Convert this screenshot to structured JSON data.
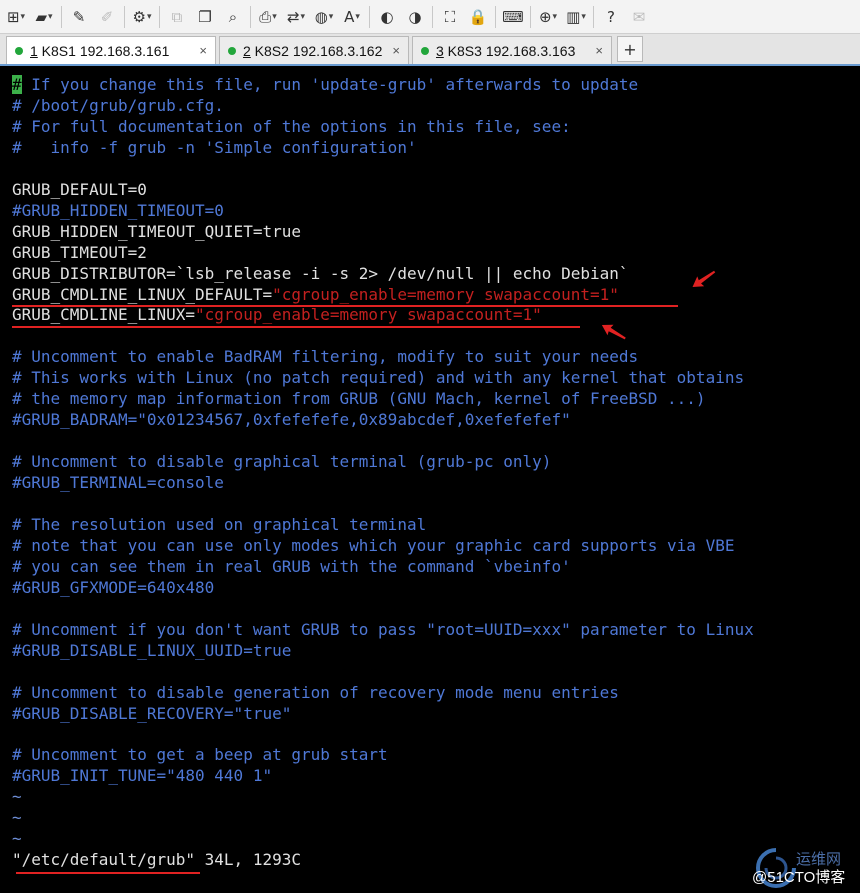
{
  "toolbar": {
    "icons": [
      {
        "name": "new-session-icon",
        "glyph": "⊞",
        "dd": true
      },
      {
        "name": "open-folder-icon",
        "glyph": "▰",
        "dd": true
      },
      {
        "sep": true
      },
      {
        "name": "connect-icon",
        "glyph": "✎"
      },
      {
        "name": "disconnect-icon",
        "glyph": "✐",
        "disabled": true
      },
      {
        "sep": true
      },
      {
        "name": "properties-icon",
        "glyph": "⚙",
        "dd": true
      },
      {
        "sep": true
      },
      {
        "name": "copy-icon",
        "glyph": "⧉",
        "disabled": true
      },
      {
        "name": "paste-icon",
        "glyph": "❐"
      },
      {
        "name": "find-icon",
        "glyph": "⌕"
      },
      {
        "sep": true
      },
      {
        "name": "print-icon",
        "glyph": "⎙",
        "dd": true
      },
      {
        "name": "transfer-icon",
        "glyph": "⇄",
        "dd": true
      },
      {
        "name": "globe-icon",
        "glyph": "◍",
        "dd": true
      },
      {
        "name": "font-icon",
        "glyph": "A",
        "dd": true
      },
      {
        "sep": true
      },
      {
        "name": "xftp-icon",
        "glyph": "◐"
      },
      {
        "name": "script-icon",
        "glyph": "◑"
      },
      {
        "sep": true
      },
      {
        "name": "fullscreen-icon",
        "glyph": "⛶"
      },
      {
        "name": "lock-icon",
        "glyph": "🔒"
      },
      {
        "sep": true
      },
      {
        "name": "keyboard-icon",
        "glyph": "⌨"
      },
      {
        "sep": true
      },
      {
        "name": "add-icon",
        "glyph": "⊕",
        "dd": true
      },
      {
        "name": "layout-icon",
        "glyph": "▥",
        "dd": true
      },
      {
        "sep": true
      },
      {
        "name": "help-icon",
        "glyph": "?"
      },
      {
        "name": "chat-icon",
        "glyph": "✉",
        "disabled": true
      }
    ]
  },
  "tabs": [
    {
      "num": "1",
      "label": " K8S1 192.168.3.161",
      "active": true
    },
    {
      "num": "2",
      "label": " K8S2 192.168.3.162",
      "active": false
    },
    {
      "num": "3",
      "label": " K8S3 192.168.3.163",
      "active": false
    }
  ],
  "tab_close_glyph": "×",
  "tab_add_glyph": "+",
  "terminal": {
    "lines": [
      [
        [
          "cursor",
          "#"
        ],
        [
          "c",
          " If you change this file, run 'update-grub' afterwards to update"
        ]
      ],
      [
        [
          "c",
          "# /boot/grub/grub.cfg."
        ]
      ],
      [
        [
          "c",
          "# For full documentation of the options in this file, see:"
        ]
      ],
      [
        [
          "c",
          "#   info -f grub -n 'Simple configuration'"
        ]
      ],
      [],
      [
        [
          "w",
          "GRUB_DEFAULT=0"
        ]
      ],
      [
        [
          "c",
          "#GRUB_HIDDEN_TIMEOUT=0"
        ]
      ],
      [
        [
          "w",
          "GRUB_HIDDEN_TIMEOUT_QUIET=true"
        ]
      ],
      [
        [
          "w",
          "GRUB_TIMEOUT=2"
        ]
      ],
      [
        [
          "w",
          "GRUB_DISTRIBUTOR=`lsb_release -i -s 2> /dev/null || echo Debian`"
        ]
      ],
      [
        [
          "w",
          "GRUB_CMDLINE_LINUX_DEFAULT="
        ],
        [
          "s",
          "\"cgroup_enable=memory swapaccount=1\""
        ]
      ],
      [
        [
          "w",
          "GRUB_CMDLINE_LINUX="
        ],
        [
          "s",
          "\"cgroup_enable=memory swapaccount=1\""
        ]
      ],
      [],
      [
        [
          "c",
          "# Uncomment to enable BadRAM filtering, modify to suit your needs"
        ]
      ],
      [
        [
          "c",
          "# This works with Linux (no patch required) and with any kernel that obtains"
        ]
      ],
      [
        [
          "c",
          "# the memory map information from GRUB (GNU Mach, kernel of FreeBSD ...)"
        ]
      ],
      [
        [
          "c",
          "#GRUB_BADRAM=\"0x01234567,0xfefefefe,0x89abcdef,0xefefefef\""
        ]
      ],
      [],
      [
        [
          "c",
          "# Uncomment to disable graphical terminal (grub-pc only)"
        ]
      ],
      [
        [
          "c",
          "#GRUB_TERMINAL=console"
        ]
      ],
      [],
      [
        [
          "c",
          "# The resolution used on graphical terminal"
        ]
      ],
      [
        [
          "c",
          "# note that you can use only modes which your graphic card supports via VBE"
        ]
      ],
      [
        [
          "c",
          "# you can see them in real GRUB with the command `vbeinfo'"
        ]
      ],
      [
        [
          "c",
          "#GRUB_GFXMODE=640x480"
        ]
      ],
      [],
      [
        [
          "c",
          "# Uncomment if you don't want GRUB to pass \"root=UUID=xxx\" parameter to Linux"
        ]
      ],
      [
        [
          "c",
          "#GRUB_DISABLE_LINUX_UUID=true"
        ]
      ],
      [],
      [
        [
          "c",
          "# Uncomment to disable generation of recovery mode menu entries"
        ]
      ],
      [
        [
          "c",
          "#GRUB_DISABLE_RECOVERY=\"true\""
        ]
      ],
      [],
      [
        [
          "c",
          "# Uncomment to get a beep at grub start"
        ]
      ],
      [
        [
          "c",
          "#GRUB_INIT_TUNE=\"480 440 1\""
        ]
      ],
      [
        [
          "t",
          "~"
        ]
      ],
      [
        [
          "t",
          "~"
        ]
      ],
      [
        [
          "t",
          "~"
        ]
      ],
      [
        [
          "w",
          "\"/etc/default/grub\" 34L, 1293C"
        ]
      ]
    ]
  },
  "watermark": {
    "line1": "运维网",
    "line2": "@51CTO博客"
  }
}
